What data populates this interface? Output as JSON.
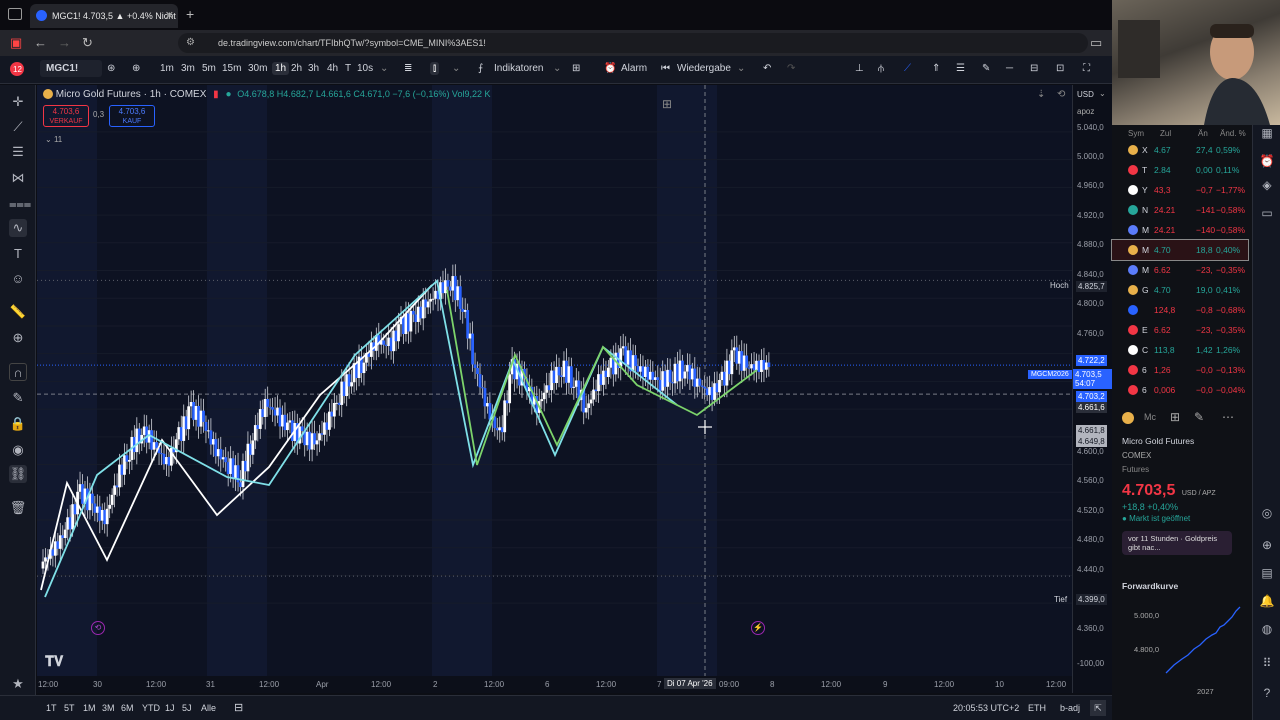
{
  "browser": {
    "tab_title": "MGC1! 4.703,5 ▲ +0.4% Nicht ...",
    "url": "de.tradingview.com/chart/TFIbhQTw/?symbol=CME_MINI%3AES1!"
  },
  "toolbar": {
    "symbol": "MGC1!",
    "intervals": [
      "1m",
      "3m",
      "5m",
      "15m",
      "30m",
      "1h",
      "2h",
      "3h",
      "4h",
      "T",
      "3h",
      "10s"
    ],
    "active_interval": "1h",
    "indicators_label": "Indikatoren",
    "alarm_label": "Alarm",
    "replay_label": "Wiedergabe"
  },
  "legend": {
    "title": "Micro Gold Futures · 1h · COMEX",
    "ohlc": "O4.678,8 H4.682,7 L4.661,6 C4.671,0 −7,6 (−0,16%) Vol9,22 K",
    "sell_price": "4.703,6",
    "sell_label": "VERKAUF",
    "spread": "0,3",
    "buy_price": "4.703,6",
    "buy_label": "KAUF",
    "indicator_count": "11"
  },
  "yaxis": {
    "currency": "USD",
    "session": "apoz",
    "ticks": [
      "5.040,0",
      "5.000,0",
      "4.960,0",
      "4.920,0",
      "4.880,0",
      "4.840,0",
      "4.800,0",
      "4.760,0",
      "4.600,0",
      "4.560,0",
      "4.520,0",
      "4.480,0",
      "4.440,0",
      "4.360,0",
      "-100,00"
    ],
    "high_label": "Hoch",
    "high_value": "4.825,7",
    "low_label": "Tief",
    "low_value": "4.399,0",
    "contract_label": "MGCM2026",
    "last_price": "4.703,5",
    "countdown": "54:07",
    "badge_1": "4.722,2",
    "badge_2": "4.703,2",
    "badge_3": "4.661,6",
    "badge_4": "4.661,8",
    "badge_5": "4.649,8"
  },
  "xaxis": {
    "labels": [
      "12:00",
      "30",
      "12:00",
      "31",
      "12:00",
      "Apr",
      "12:00",
      "2",
      "12:00",
      "6",
      "12:00",
      "7",
      "09:00",
      "8",
      "12:00",
      "9",
      "12:00",
      "10",
      "12:00"
    ],
    "crosshair_label": "Di 07 Apr '26"
  },
  "bottombar": {
    "ranges": [
      "1T",
      "5T",
      "1M",
      "3M",
      "6M",
      "YTD",
      "1J",
      "5J",
      "Alle"
    ],
    "clock": "20:05:53 UTC+2",
    "session": "ETH",
    "adj": "b-adj"
  },
  "watchlist": {
    "headers": [
      "Sym",
      "Zul",
      "Än",
      "Änd. %"
    ],
    "rows": [
      {
        "sym": "X",
        "price": "4.67",
        "chg": "27,4",
        "pct": "0,59%",
        "color": "#e8b04a",
        "up": true
      },
      {
        "sym": "T",
        "price": "2.84",
        "chg": "0,00",
        "pct": "0,11%",
        "color": "#f23645",
        "up": true
      },
      {
        "sym": "Y",
        "price": "43,3",
        "chg": "−0,7",
        "pct": "−1,77%",
        "color": "#ffffff",
        "up": false
      },
      {
        "sym": "N",
        "price": "24.21",
        "chg": "−141",
        "pct": "−0,58%",
        "color": "#26a69a",
        "up": false
      },
      {
        "sym": "M",
        "price": "24.21",
        "chg": "−140",
        "pct": "−0,58%",
        "color": "#5b7cfa",
        "up": false
      },
      {
        "sym": "M",
        "price": "4.70",
        "chg": "18,8",
        "pct": "0,40%",
        "color": "#e8b04a",
        "up": true
      },
      {
        "sym": "M",
        "price": "6.62",
        "chg": "−23,",
        "pct": "−0,35%",
        "color": "#5b7cfa",
        "up": false
      },
      {
        "sym": "G",
        "price": "4.70",
        "chg": "19,0",
        "pct": "0,41%",
        "color": "#e8b04a",
        "up": true
      },
      {
        "sym": "",
        "price": "124,8",
        "chg": "−0,8",
        "pct": "−0,68%",
        "color": "#2962ff",
        "up": false
      },
      {
        "sym": "E",
        "price": "6.62",
        "chg": "−23,",
        "pct": "−0,35%",
        "color": "#f23645",
        "up": false
      },
      {
        "sym": "C",
        "price": "113,8",
        "chg": "1,42",
        "pct": "1,26%",
        "color": "#ffffff",
        "up": true
      },
      {
        "sym": "6",
        "price": "1,26",
        "chg": "−0,0",
        "pct": "−0,13%",
        "color": "#f23645",
        "up": false
      },
      {
        "sym": "6",
        "price": "0,006",
        "chg": "−0,0",
        "pct": "−0,04%",
        "color": "#f23645",
        "up": false
      }
    ]
  },
  "details": {
    "name": "Micro Gold Futures",
    "exchange": "COMEX",
    "type": "Futures",
    "price": "4.703,5",
    "price_unit": "USD / APZ",
    "change": "+18,8 +0,40%",
    "market_status": "Markt ist geöffnet",
    "news": "vor 11 Stunden · Goldpreis gibt nac...",
    "forward_label": "Forwardkurve",
    "forward_y1": "5.000,0",
    "forward_y2": "4.800,0",
    "forward_x": "2027"
  },
  "chart_data": {
    "type": "candlestick",
    "title": "Micro Gold Futures · 1h · COMEX",
    "close_series": [
      4420,
      4440,
      4470,
      4520,
      4500,
      4480,
      4540,
      4580,
      4610,
      4590,
      4560,
      4600,
      4640,
      4620,
      4580,
      4560,
      4540,
      4600,
      4650,
      4630,
      4610,
      4600,
      4590,
      4620,
      4660,
      4690,
      4710,
      4740,
      4730,
      4760,
      4770,
      4790,
      4810,
      4825,
      4790,
      4700,
      4640,
      4600,
      4700,
      4680,
      4640,
      4680,
      4700,
      4680,
      4640,
      4680,
      4700,
      4720,
      4700,
      4690,
      4680,
      4690,
      4700,
      4680,
      4660,
      4680,
      4720,
      4700,
      4703
    ],
    "ylim": [
      4340,
      5050
    ],
    "high": 4825.7,
    "low": 4399.0,
    "last": 4703.5
  }
}
